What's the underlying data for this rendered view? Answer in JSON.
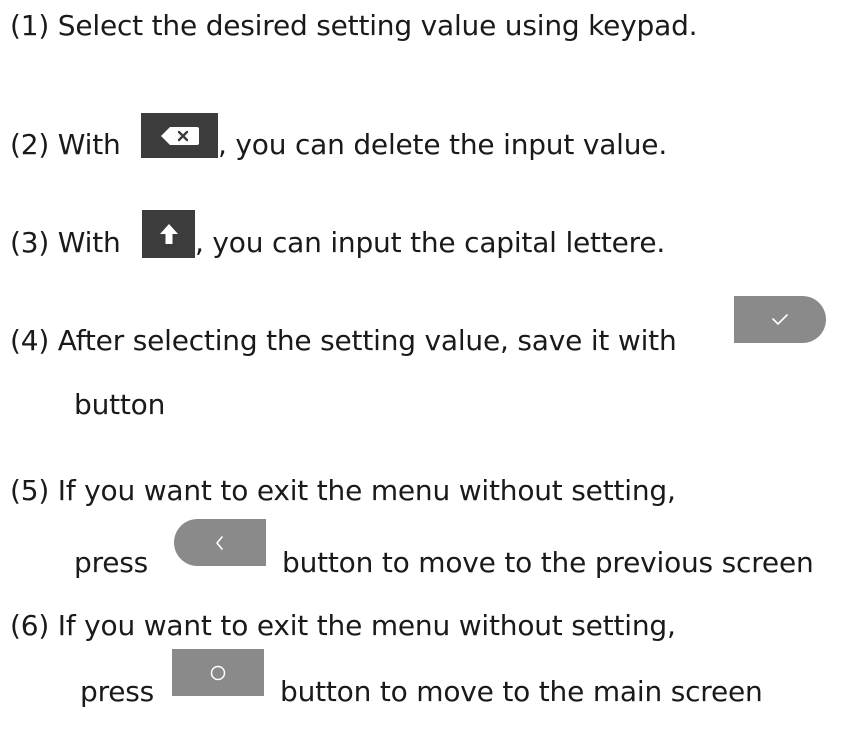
{
  "instructions": {
    "step1": "(1) Select the desired setting value using keypad.",
    "step2_prefix": "(2) With",
    "step2_suffix": ", you can delete the input value.",
    "step3_prefix": "(3) With",
    "step3_suffix": ", you can input the capital lettere.",
    "step4_line1": "(4) After selecting the setting value, save it with",
    "step4_line2": "button",
    "step5_line1": "(5) If you want to exit the menu without setting,",
    "step5_line2_prefix": "press",
    "step5_line2_suffix": "button to move to the previous screen",
    "step6_line1": "(6) If you want to exit the menu without setting,",
    "step6_line2_prefix": "press",
    "step6_line2_suffix": "button to move to the main screen"
  },
  "icons": {
    "backspace": "backspace-icon",
    "shift": "shift-arrow-icon",
    "confirm": "checkmark-icon",
    "back": "chevron-left-icon",
    "home": "circle-home-icon"
  },
  "colors": {
    "dark_key": "#3c3c3c",
    "gray_key": "#8a8a8a"
  }
}
